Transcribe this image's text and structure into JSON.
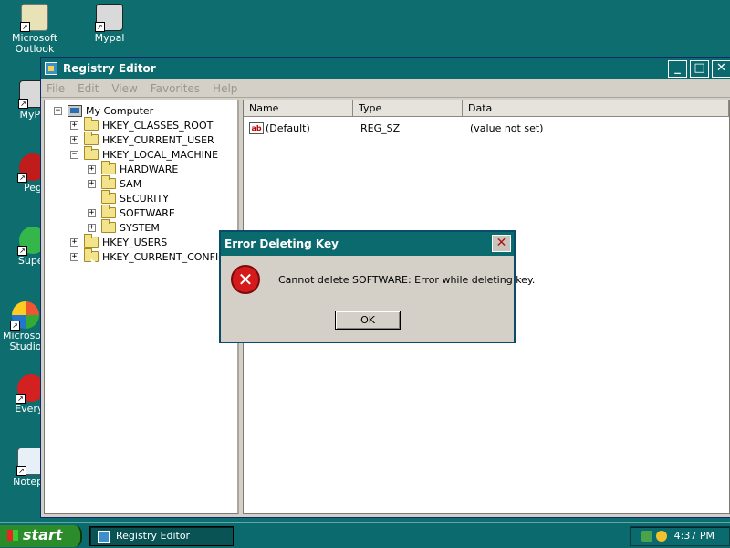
{
  "desktop": {
    "icons": [
      {
        "label": "Microsoft Outlook",
        "icon": "outlook-icon"
      },
      {
        "label": "Mypal",
        "icon": "mypal-icon"
      },
      {
        "label": "MyPa",
        "icon": "mypal-icon"
      },
      {
        "label": "Peg",
        "icon": "pegasus-icon"
      },
      {
        "label": "Super",
        "icon": "super-icon"
      },
      {
        "label": "Microsoft Studio",
        "icon": "studio-icon"
      },
      {
        "label": "Everyt",
        "icon": "everything-icon"
      },
      {
        "label": "Notepa",
        "icon": "notepad-icon"
      }
    ]
  },
  "window": {
    "title": "Registry Editor",
    "controls": {
      "minimize": "_",
      "maximize": "□",
      "close": "✕"
    },
    "menu": [
      "File",
      "Edit",
      "View",
      "Favorites",
      "Help"
    ]
  },
  "tree": {
    "root": "My Computer",
    "items": [
      {
        "label": "HKEY_CLASSES_ROOT",
        "expander": "+"
      },
      {
        "label": "HKEY_CURRENT_USER",
        "expander": "+"
      },
      {
        "label": "HKEY_LOCAL_MACHINE",
        "expander": "−"
      },
      {
        "label": "HARDWARE",
        "expander": "+"
      },
      {
        "label": "SAM",
        "expander": "+"
      },
      {
        "label": "SECURITY",
        "expander": ""
      },
      {
        "label": "SOFTWARE",
        "expander": "+"
      },
      {
        "label": "SYSTEM",
        "expander": "+"
      },
      {
        "label": "HKEY_USERS",
        "expander": "+"
      },
      {
        "label": "HKEY_CURRENT_CONFIG",
        "expander": "+"
      }
    ]
  },
  "list": {
    "columns": [
      "Name",
      "Type",
      "Data"
    ],
    "rows": [
      {
        "name": "(Default)",
        "type": "REG_SZ",
        "data": "(value not set)"
      }
    ]
  },
  "dialog": {
    "title": "Error Deleting Key",
    "close": "✕",
    "icon": "error-icon",
    "message": "Cannot delete SOFTWARE:  Error while deleting key.",
    "ok": "OK"
  },
  "taskbar": {
    "start": "start",
    "task": "Registry Editor",
    "clock": "4:37 PM"
  },
  "colors": {
    "desktop": "#0d6d6f",
    "titlebar": "#0b6a6d",
    "error": "#d41a1a"
  }
}
